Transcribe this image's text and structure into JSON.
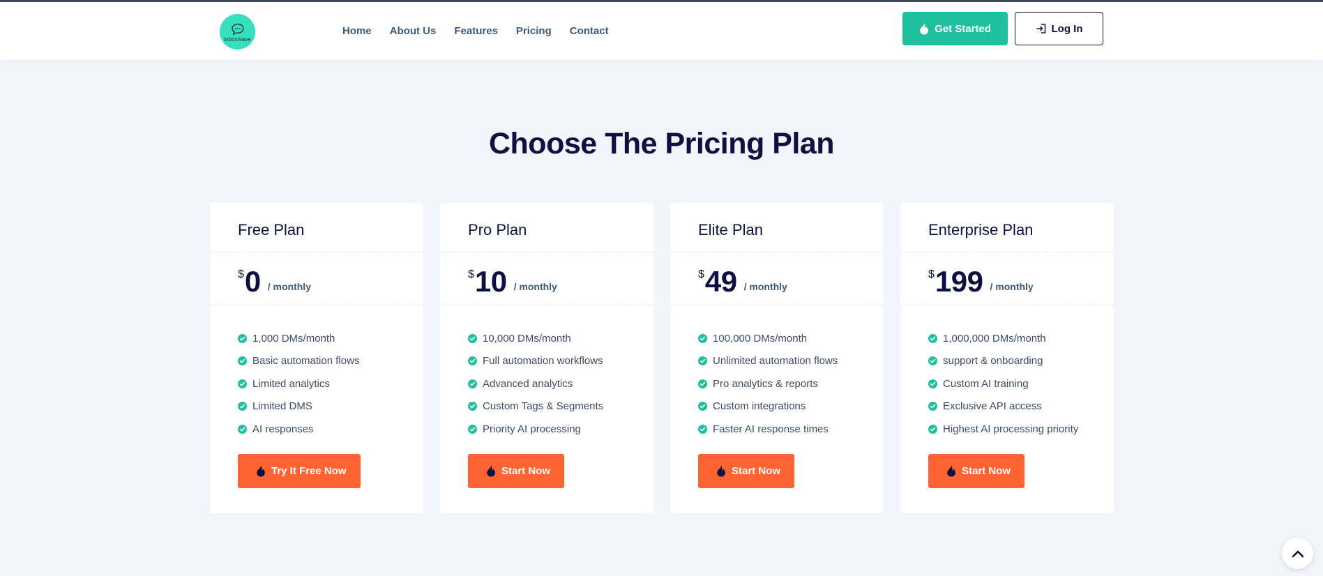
{
  "brand": {
    "logo_text": "inboxwave",
    "accent": "#1ec0a0",
    "cta_color": "#ff6331",
    "heading_color": "#0d1040"
  },
  "nav": {
    "items": [
      {
        "label": "Home"
      },
      {
        "label": "About Us"
      },
      {
        "label": "Features"
      },
      {
        "label": "Pricing"
      },
      {
        "label": "Contact"
      }
    ],
    "get_started_label": "Get Started",
    "get_started_icon": "flame-icon",
    "login_label": "Log In",
    "login_icon": "sign-in-icon"
  },
  "pricing": {
    "title": "Choose The Pricing Plan",
    "plans": [
      {
        "name": "Free Plan",
        "currency": "$",
        "amount": "0",
        "period": "/ monthly",
        "features": [
          "1,000 DMs/month",
          "Basic automation flows",
          "Limited analytics",
          "Limited DMS",
          "AI responses"
        ],
        "cta": "Try It Free Now"
      },
      {
        "name": "Pro Plan",
        "currency": "$",
        "amount": "10",
        "period": "/ monthly",
        "features": [
          "10,000 DMs/month",
          "Full automation workflows",
          "Advanced analytics",
          "Custom Tags & Segments",
          "Priority AI processing"
        ],
        "cta": "Start Now"
      },
      {
        "name": "Elite Plan",
        "currency": "$",
        "amount": "49",
        "period": "/ monthly",
        "features": [
          "100,000 DMs/month",
          "Unlimited automation flows",
          "Pro analytics & reports",
          "Custom integrations",
          "Faster AI response times"
        ],
        "cta": "Start Now"
      },
      {
        "name": "Enterprise Plan",
        "currency": "$",
        "amount": "199",
        "period": "/ monthly",
        "features": [
          "1,000,000 DMs/month",
          "support & onboarding",
          "Custom AI training",
          "Exclusive API access",
          "Highest AI processing priority"
        ],
        "cta": "Start Now"
      }
    ]
  },
  "scroll_top_icon": "chevron-up-icon"
}
